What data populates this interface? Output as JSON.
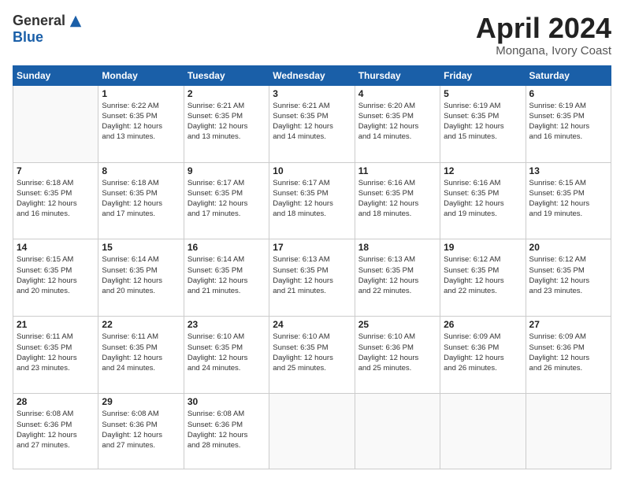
{
  "logo": {
    "general": "General",
    "blue": "Blue"
  },
  "title": "April 2024",
  "subtitle": "Mongana, Ivory Coast",
  "days_header": [
    "Sunday",
    "Monday",
    "Tuesday",
    "Wednesday",
    "Thursday",
    "Friday",
    "Saturday"
  ],
  "weeks": [
    [
      {
        "num": "",
        "info": ""
      },
      {
        "num": "1",
        "info": "Sunrise: 6:22 AM\nSunset: 6:35 PM\nDaylight: 12 hours\nand 13 minutes."
      },
      {
        "num": "2",
        "info": "Sunrise: 6:21 AM\nSunset: 6:35 PM\nDaylight: 12 hours\nand 13 minutes."
      },
      {
        "num": "3",
        "info": "Sunrise: 6:21 AM\nSunset: 6:35 PM\nDaylight: 12 hours\nand 14 minutes."
      },
      {
        "num": "4",
        "info": "Sunrise: 6:20 AM\nSunset: 6:35 PM\nDaylight: 12 hours\nand 14 minutes."
      },
      {
        "num": "5",
        "info": "Sunrise: 6:19 AM\nSunset: 6:35 PM\nDaylight: 12 hours\nand 15 minutes."
      },
      {
        "num": "6",
        "info": "Sunrise: 6:19 AM\nSunset: 6:35 PM\nDaylight: 12 hours\nand 16 minutes."
      }
    ],
    [
      {
        "num": "7",
        "info": "Sunrise: 6:18 AM\nSunset: 6:35 PM\nDaylight: 12 hours\nand 16 minutes."
      },
      {
        "num": "8",
        "info": "Sunrise: 6:18 AM\nSunset: 6:35 PM\nDaylight: 12 hours\nand 17 minutes."
      },
      {
        "num": "9",
        "info": "Sunrise: 6:17 AM\nSunset: 6:35 PM\nDaylight: 12 hours\nand 17 minutes."
      },
      {
        "num": "10",
        "info": "Sunrise: 6:17 AM\nSunset: 6:35 PM\nDaylight: 12 hours\nand 18 minutes."
      },
      {
        "num": "11",
        "info": "Sunrise: 6:16 AM\nSunset: 6:35 PM\nDaylight: 12 hours\nand 18 minutes."
      },
      {
        "num": "12",
        "info": "Sunrise: 6:16 AM\nSunset: 6:35 PM\nDaylight: 12 hours\nand 19 minutes."
      },
      {
        "num": "13",
        "info": "Sunrise: 6:15 AM\nSunset: 6:35 PM\nDaylight: 12 hours\nand 19 minutes."
      }
    ],
    [
      {
        "num": "14",
        "info": "Sunrise: 6:15 AM\nSunset: 6:35 PM\nDaylight: 12 hours\nand 20 minutes."
      },
      {
        "num": "15",
        "info": "Sunrise: 6:14 AM\nSunset: 6:35 PM\nDaylight: 12 hours\nand 20 minutes."
      },
      {
        "num": "16",
        "info": "Sunrise: 6:14 AM\nSunset: 6:35 PM\nDaylight: 12 hours\nand 21 minutes."
      },
      {
        "num": "17",
        "info": "Sunrise: 6:13 AM\nSunset: 6:35 PM\nDaylight: 12 hours\nand 21 minutes."
      },
      {
        "num": "18",
        "info": "Sunrise: 6:13 AM\nSunset: 6:35 PM\nDaylight: 12 hours\nand 22 minutes."
      },
      {
        "num": "19",
        "info": "Sunrise: 6:12 AM\nSunset: 6:35 PM\nDaylight: 12 hours\nand 22 minutes."
      },
      {
        "num": "20",
        "info": "Sunrise: 6:12 AM\nSunset: 6:35 PM\nDaylight: 12 hours\nand 23 minutes."
      }
    ],
    [
      {
        "num": "21",
        "info": "Sunrise: 6:11 AM\nSunset: 6:35 PM\nDaylight: 12 hours\nand 23 minutes."
      },
      {
        "num": "22",
        "info": "Sunrise: 6:11 AM\nSunset: 6:35 PM\nDaylight: 12 hours\nand 24 minutes."
      },
      {
        "num": "23",
        "info": "Sunrise: 6:10 AM\nSunset: 6:35 PM\nDaylight: 12 hours\nand 24 minutes."
      },
      {
        "num": "24",
        "info": "Sunrise: 6:10 AM\nSunset: 6:35 PM\nDaylight: 12 hours\nand 25 minutes."
      },
      {
        "num": "25",
        "info": "Sunrise: 6:10 AM\nSunset: 6:36 PM\nDaylight: 12 hours\nand 25 minutes."
      },
      {
        "num": "26",
        "info": "Sunrise: 6:09 AM\nSunset: 6:36 PM\nDaylight: 12 hours\nand 26 minutes."
      },
      {
        "num": "27",
        "info": "Sunrise: 6:09 AM\nSunset: 6:36 PM\nDaylight: 12 hours\nand 26 minutes."
      }
    ],
    [
      {
        "num": "28",
        "info": "Sunrise: 6:08 AM\nSunset: 6:36 PM\nDaylight: 12 hours\nand 27 minutes."
      },
      {
        "num": "29",
        "info": "Sunrise: 6:08 AM\nSunset: 6:36 PM\nDaylight: 12 hours\nand 27 minutes."
      },
      {
        "num": "30",
        "info": "Sunrise: 6:08 AM\nSunset: 6:36 PM\nDaylight: 12 hours\nand 28 minutes."
      },
      {
        "num": "",
        "info": ""
      },
      {
        "num": "",
        "info": ""
      },
      {
        "num": "",
        "info": ""
      },
      {
        "num": "",
        "info": ""
      }
    ]
  ]
}
